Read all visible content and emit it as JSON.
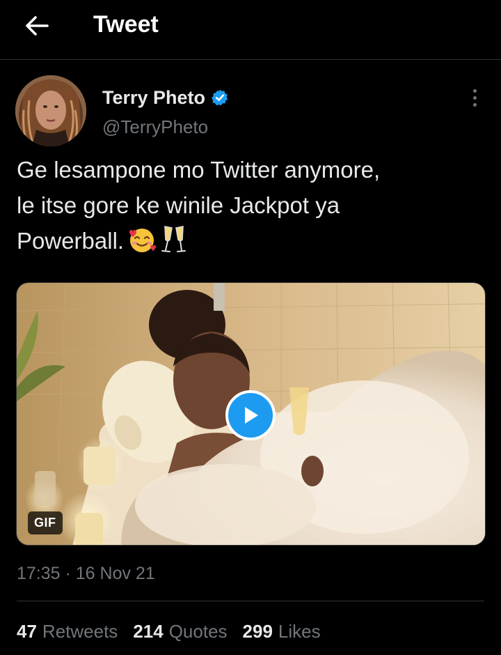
{
  "header": {
    "title": "Tweet",
    "back_icon": "arrow-left-icon"
  },
  "author": {
    "name": "Terry Pheto",
    "handle": "@TerryPheto",
    "verified": true,
    "verified_color": "#1d9bf0"
  },
  "tweet": {
    "text": "Ge lesampone mo Twitter anymore,\nle itse gore ke winile Jackpot ya\nPowerball.",
    "emojis": [
      "smiling-face-with-hearts",
      "clinking-glasses"
    ]
  },
  "media": {
    "badge": "GIF",
    "play_icon": "play-icon",
    "accent": "#1d9bf0"
  },
  "meta": {
    "timestamp": "17:35 · 16 Nov 21"
  },
  "stats": [
    {
      "count": "47",
      "label": "Retweets"
    },
    {
      "count": "214",
      "label": "Quotes"
    },
    {
      "count": "299",
      "label": "Likes"
    }
  ]
}
